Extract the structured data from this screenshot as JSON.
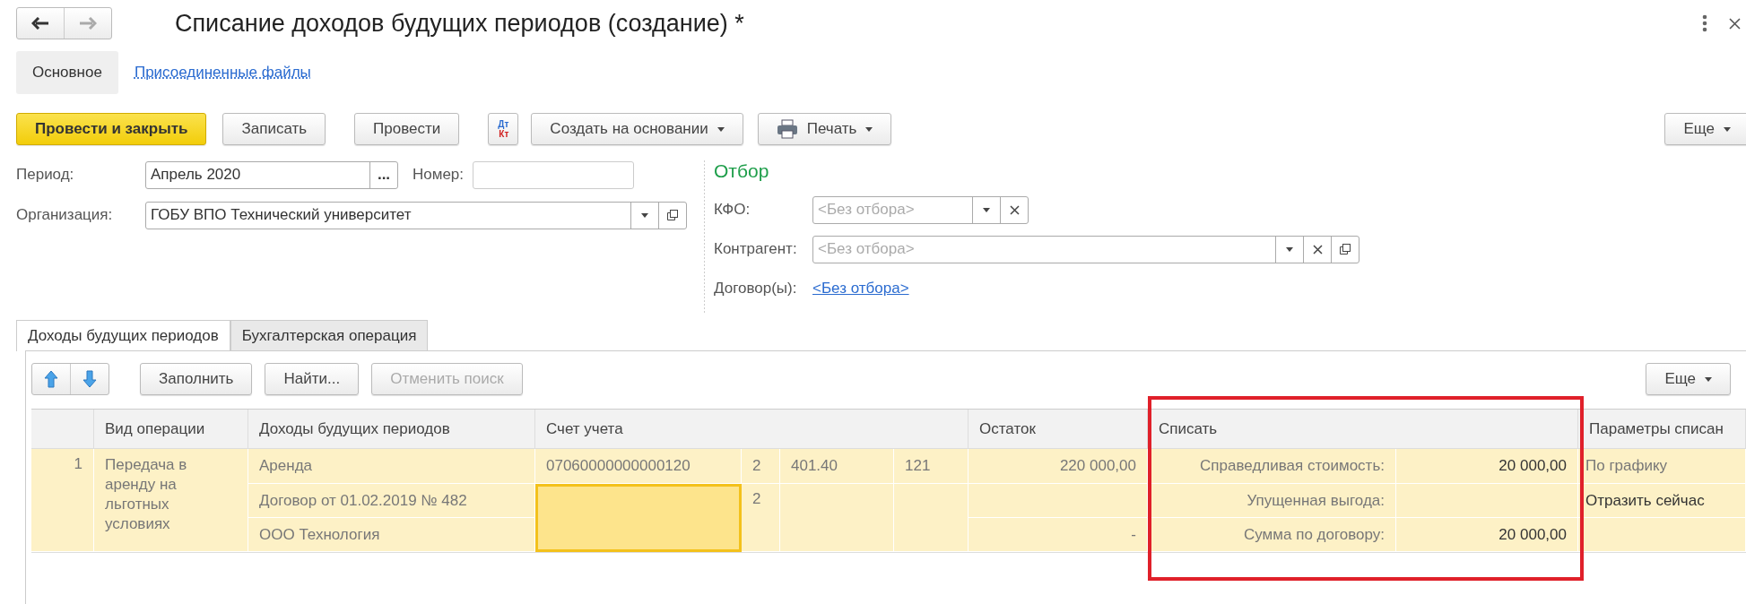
{
  "window": {
    "title": "Списание доходов будущих периодов (создание) *"
  },
  "nav_buttons": [
    {
      "kind": "back",
      "disabled": false
    },
    {
      "kind": "forward",
      "disabled": true
    }
  ],
  "form_tabs": [
    {
      "label": "Основное",
      "selected": true
    },
    {
      "label": "Присоединенные файлы",
      "selected": false
    }
  ],
  "toolbar": [
    {
      "kind": "default",
      "label": "Провести и закрыть"
    },
    {
      "kind": "plain",
      "label": "Записать"
    },
    {
      "kind": "plain",
      "label": "Провести"
    },
    {
      "kind": "dtkt",
      "label": "Дт",
      "label_bottom": "Кт"
    },
    {
      "kind": "menu",
      "label": "Создать на основании"
    },
    {
      "kind": "print",
      "label": "Печать"
    }
  ],
  "toolbar_more": "Еще",
  "period": {
    "label": "Период:",
    "value": "Апрель 2020",
    "choose": "..."
  },
  "number": {
    "label": "Номер:"
  },
  "organization": {
    "label": "Организация:",
    "value": "ГОБУ ВПО Технический университет"
  },
  "filter": {
    "title": "Отбор",
    "kfo": {
      "label": "КФО:",
      "placeholder": "<Без отбора>"
    },
    "counterparty": {
      "label": "Контрагент:",
      "placeholder": "<Без отбора>"
    },
    "contracts": {
      "label": "Договор(ы):",
      "link": "<Без отбора>"
    }
  },
  "tabs": [
    {
      "label": "Доходы будущих периодов",
      "selected": true
    },
    {
      "label": "Бухгалтерская операция",
      "selected": false
    }
  ],
  "table_toolbar": [
    {
      "label": "Заполнить",
      "disabled": false
    },
    {
      "label": "Найти...",
      "disabled": false
    },
    {
      "label": "Отменить поиск",
      "disabled": true
    }
  ],
  "table_more": "Еще",
  "table": {
    "columns": [
      "Вид операции",
      "Доходы будущих периодов",
      "Счет учета",
      "Остаток",
      "Списать",
      "Параметры списан"
    ],
    "rows": [
      {
        "number": "1",
        "selected": true,
        "operation": "Передача в аренду на льготных условиях",
        "income": [
          "Аренда",
          "Договор от 01.02.2019 № 482",
          "ООО Технология"
        ],
        "account": "07060000000000120",
        "account_parts": [
          "2",
          "401.40",
          "121"
        ],
        "account_second": {
          "focused": true,
          "part": "2"
        },
        "balance": "220 000,00",
        "balance_note": "-",
        "write_off": [
          {
            "label": "Справедливая стоимость:",
            "value": "20 000,00"
          },
          {
            "label": "Упущенная выгода:"
          },
          {
            "label": "Сумма по договору:",
            "value": "20 000,00"
          }
        ],
        "params": [
          {
            "text": "По графику",
            "muted": true
          },
          {
            "text": "Отразить сейчас",
            "muted": false
          }
        ]
      }
    ]
  }
}
